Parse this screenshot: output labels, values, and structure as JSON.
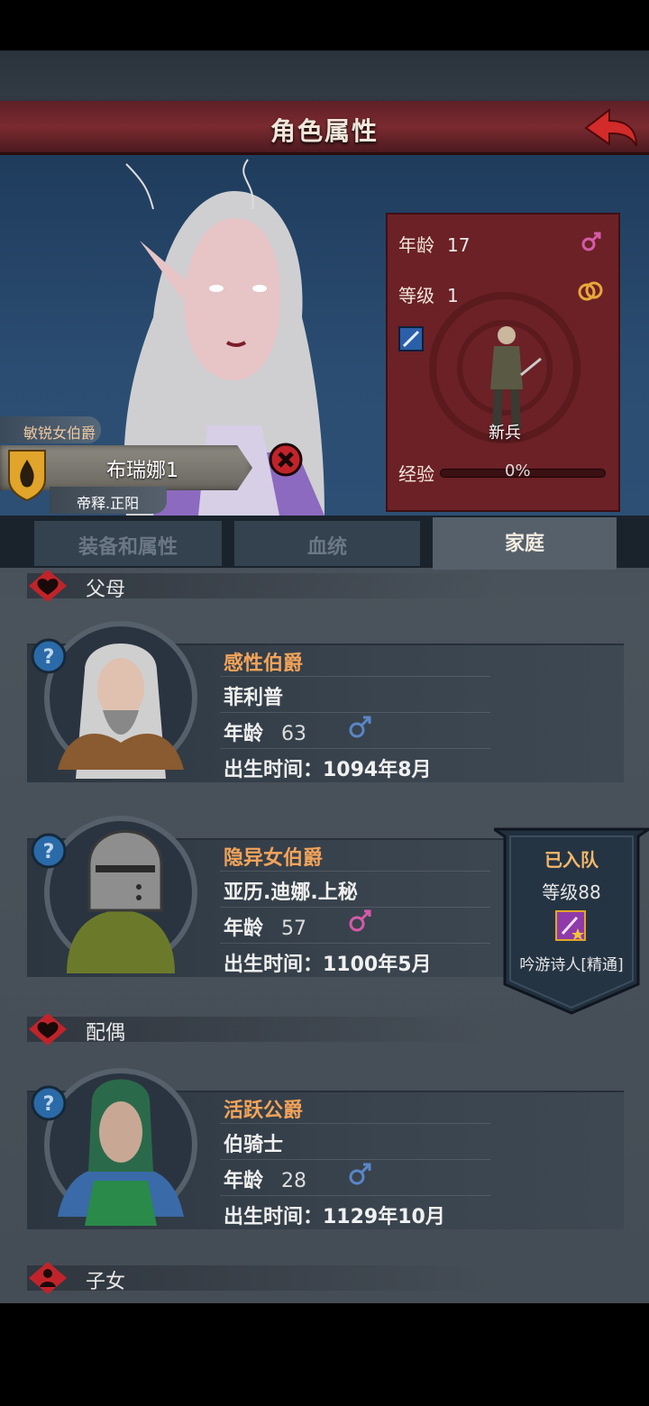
{
  "header": {
    "title": "角色属性"
  },
  "character": {
    "title_tag": "敏锐女伯爵",
    "name": "布瑞娜1",
    "house": "帝释.正阳"
  },
  "stats": {
    "age_label": "年龄",
    "age_value": "17",
    "level_label": "等级",
    "level_value": "1",
    "rank": "新兵",
    "exp_label": "经验",
    "exp_value": "0%"
  },
  "tabs": [
    {
      "label": "装备和属性",
      "active": false
    },
    {
      "label": "血统",
      "active": false
    },
    {
      "label": "家庭",
      "active": true
    }
  ],
  "sections": {
    "parents": "父母",
    "spouse": "配偶",
    "children": "子女"
  },
  "family": {
    "father": {
      "title": "感性伯爵",
      "name": "菲利普",
      "age_label": "年龄",
      "age": "63",
      "gender": "male",
      "birth": "出生时间：1094年8月"
    },
    "mother": {
      "title": "隐异女伯爵",
      "name": "亚历.迪娜.上秘",
      "age_label": "年龄",
      "age": "57",
      "gender": "female",
      "birth": "出生时间：1100年5月"
    },
    "spouse": {
      "title": "活跃公爵",
      "name": "伯骑士",
      "age_label": "年龄",
      "age": "28",
      "gender": "male",
      "birth": "出生时间：1129年10月"
    }
  },
  "joined_banner": {
    "status": "已入队",
    "level": "等级88",
    "profession": "吟游诗人[精通]"
  },
  "colors": {
    "accent_orange": "#f2a35a",
    "female": "#d65aa8",
    "male": "#5a86c8",
    "header_red": "#7a2a30"
  }
}
